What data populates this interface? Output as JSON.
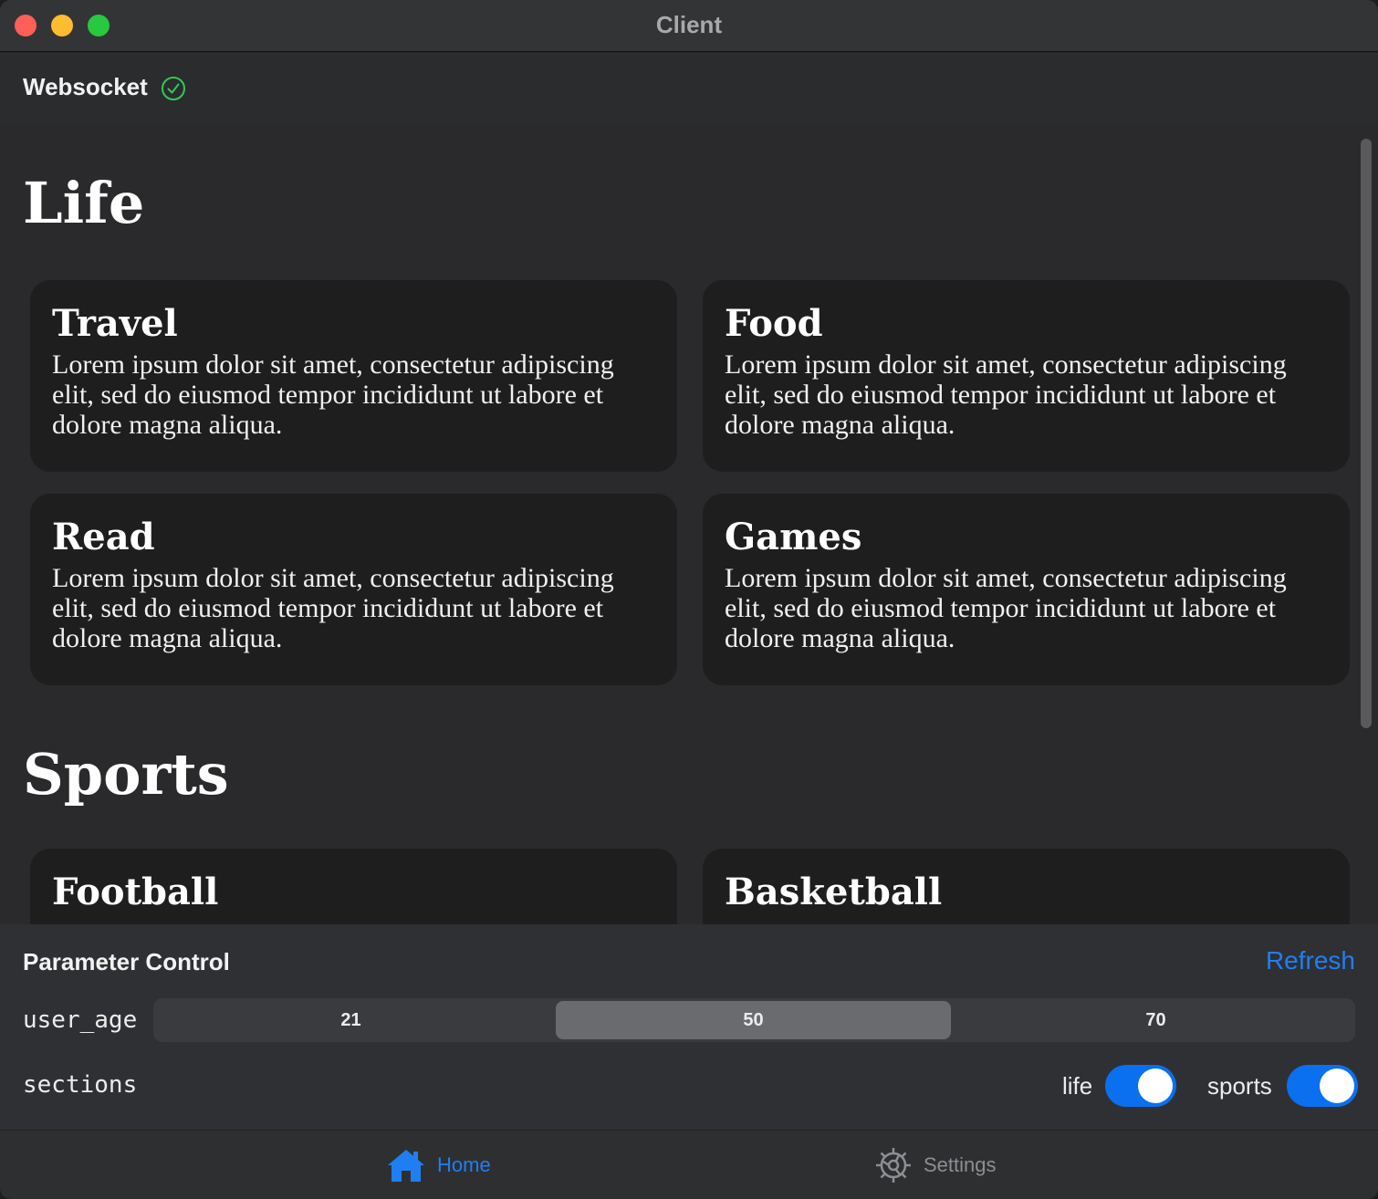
{
  "window": {
    "title": "Client"
  },
  "header": {
    "label": "Websocket",
    "status_icon": "check-circle-icon",
    "status_color": "#34c759"
  },
  "sections": [
    {
      "title": "Life",
      "cards": [
        {
          "title": "Travel",
          "text": "Lorem ipsum dolor sit amet, consectetur adipiscing elit, sed do eiusmod tempor incididunt ut labore et dolore magna aliqua."
        },
        {
          "title": "Food",
          "text": "Lorem ipsum dolor sit amet, consectetur adipiscing elit, sed do eiusmod tempor incididunt ut labore et dolore magna aliqua."
        },
        {
          "title": "Read",
          "text": "Lorem ipsum dolor sit amet, consectetur adipiscing elit, sed do eiusmod tempor incididunt ut labore et dolore magna aliqua."
        },
        {
          "title": "Games",
          "text": "Lorem ipsum dolor sit amet, consectetur adipiscing elit, sed do eiusmod tempor incididunt ut labore et dolore magna aliqua."
        }
      ]
    },
    {
      "title": "Sports",
      "cards": [
        {
          "title": "Football"
        },
        {
          "title": "Basketball"
        }
      ]
    }
  ],
  "params": {
    "title": "Parameter Control",
    "refresh_label": "Refresh",
    "user_age": {
      "label": "user_age",
      "options": [
        "21",
        "50",
        "70"
      ],
      "selected": "50"
    },
    "sections": {
      "label": "sections",
      "toggles": [
        {
          "label": "life",
          "on": true
        },
        {
          "label": "sports",
          "on": true
        }
      ]
    }
  },
  "tabbar": {
    "tabs": [
      {
        "label": "Home",
        "icon": "house-icon",
        "active": true
      },
      {
        "label": "Settings",
        "icon": "gear-icon",
        "active": false
      }
    ]
  },
  "colors": {
    "accent": "#1f7ff2",
    "toggle_on": "#0a70f0",
    "inactive_tab": "#8e8e93"
  }
}
